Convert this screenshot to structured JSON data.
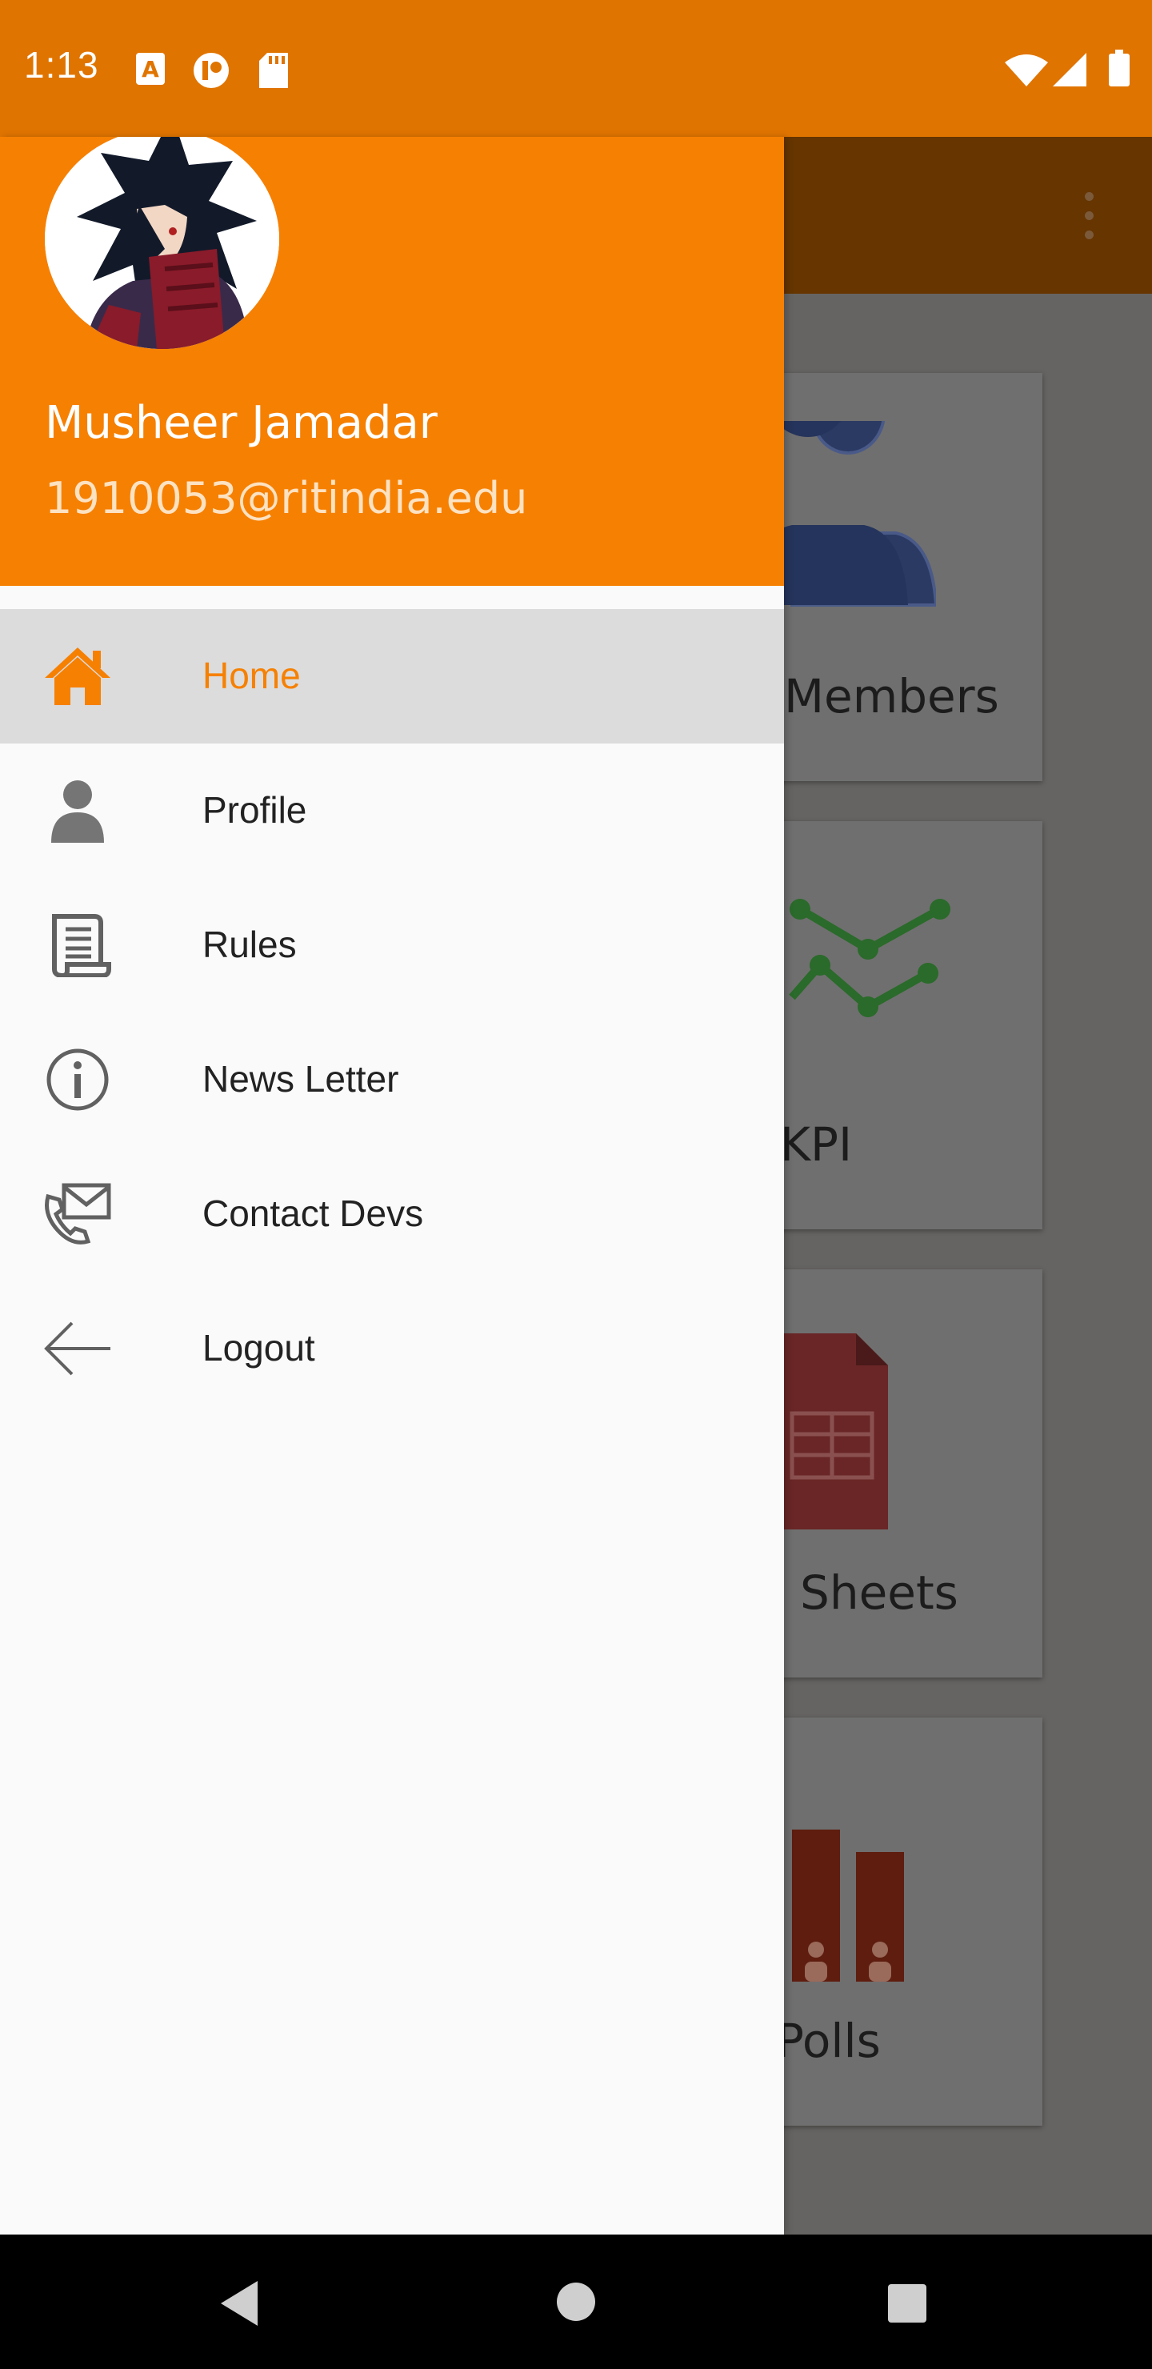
{
  "status_bar": {
    "time": "1:13",
    "icons": [
      "text-notification-icon",
      "app-notification-icon",
      "sd-card-icon",
      "wifi-icon",
      "signal-icon",
      "battery-icon"
    ]
  },
  "background_app": {
    "cards": [
      {
        "label": "Members",
        "icon": "members-icon"
      },
      {
        "label": "KPI",
        "icon": "kpi-chart-icon"
      },
      {
        "label": "Sheets",
        "icon": "sheets-icon"
      },
      {
        "label": "Polls",
        "icon": "polls-icon"
      }
    ]
  },
  "drawer": {
    "user": {
      "name": "Musheer Jamadar",
      "email": "1910053@ritindia.edu"
    },
    "items": [
      {
        "label": "Home",
        "icon": "home-icon",
        "active": true
      },
      {
        "label": "Profile",
        "icon": "person-icon",
        "active": false
      },
      {
        "label": "Rules",
        "icon": "scroll-icon",
        "active": false
      },
      {
        "label": "News Letter",
        "icon": "info-icon",
        "active": false
      },
      {
        "label": "Contact Devs",
        "icon": "contact-mail-icon",
        "active": false
      },
      {
        "label": "Logout",
        "icon": "arrow-back-icon",
        "active": false
      }
    ]
  },
  "colors": {
    "accent": "#f68002",
    "status_bar": "#e07400",
    "drawer_bg": "#fafafa",
    "active_item_bg": "#dcdcdc"
  }
}
